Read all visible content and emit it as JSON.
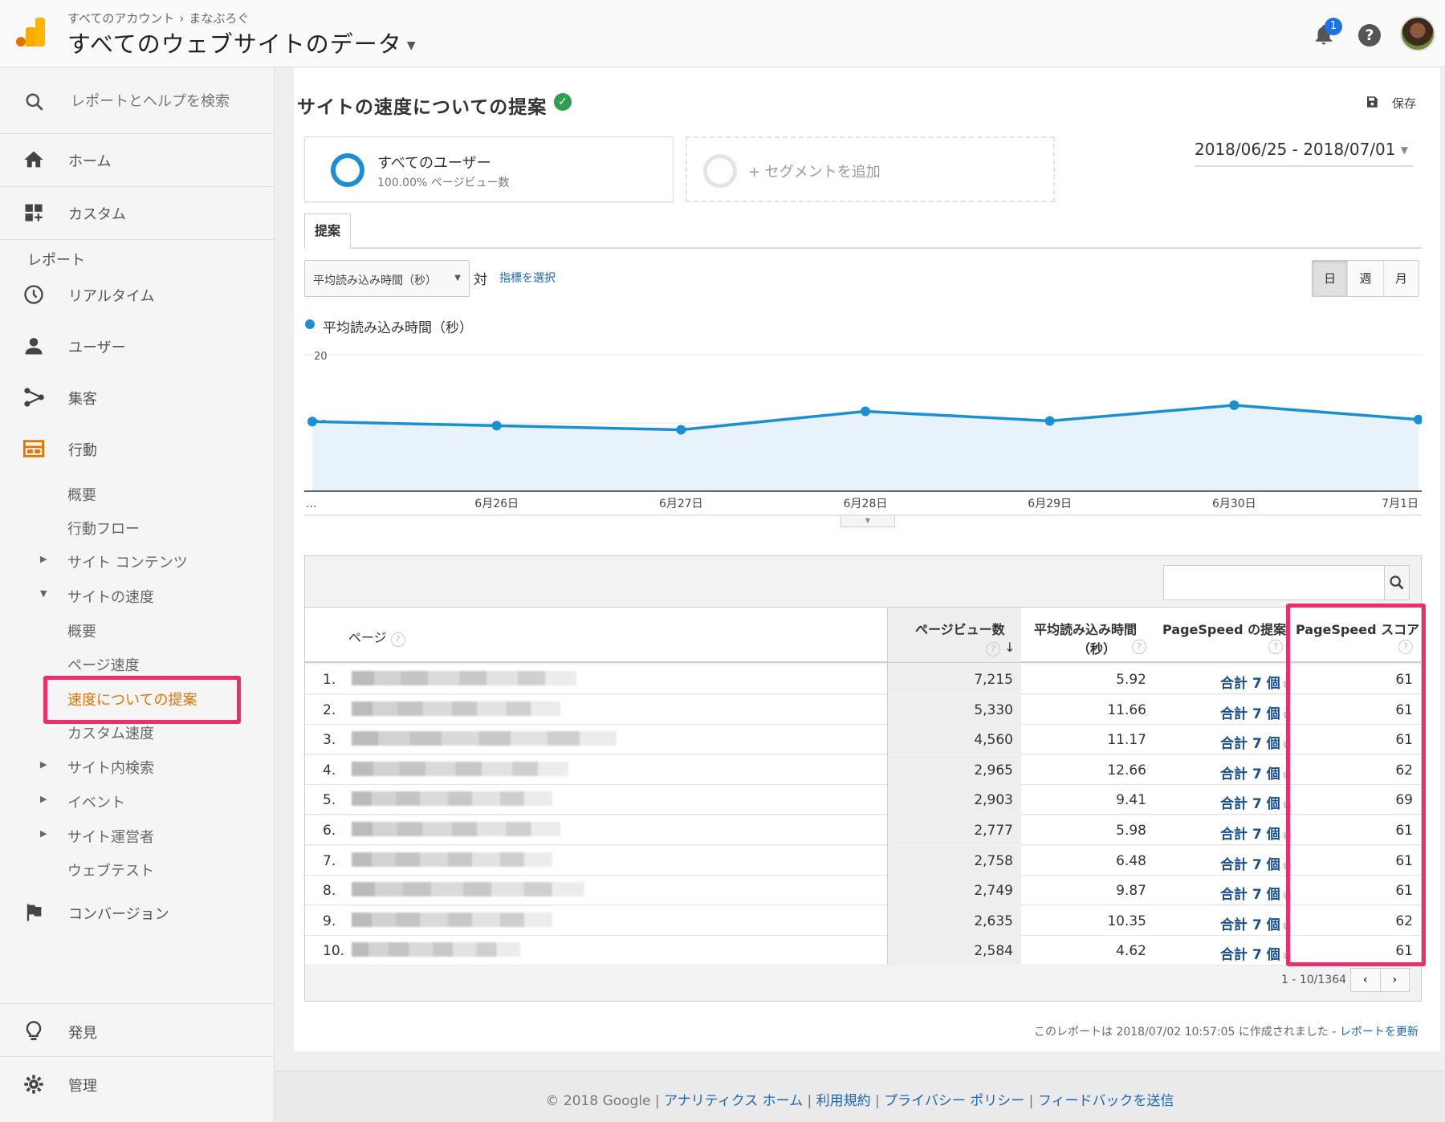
{
  "header": {
    "breadcrumb_account": "すべてのアカウント",
    "breadcrumb_property": "まなぶろぐ",
    "view_title": "すべてのウェブサイトのデータ",
    "notification_count": "1"
  },
  "sidebar": {
    "search_placeholder": "レポートとヘルプを検索",
    "home": "ホーム",
    "custom": "カスタム",
    "reports_heading": "レポート",
    "realtime": "リアルタイム",
    "users": "ユーザー",
    "acquisition": "集客",
    "behavior": "行動",
    "behavior_items": {
      "overview": "概要",
      "flow": "行動フロー",
      "site_content": "サイト コンテンツ",
      "site_speed": "サイトの速度",
      "speed_overview": "概要",
      "page_timings": "ページ速度",
      "speed_suggestions": "速度についての提案",
      "user_timings": "カスタム速度",
      "site_search": "サイト内検索",
      "events": "イベント",
      "publisher": "サイト運営者",
      "experiments": "ウェブテスト"
    },
    "conversions": "コンバージョン",
    "discover": "発見",
    "admin": "管理"
  },
  "report": {
    "title": "サイトの速度についての提案",
    "save_label": "保存",
    "segment_1_name": "すべてのユーザー",
    "segment_1_detail": "100.00% ページビュー数",
    "segment_add": "+ セグメントを追加",
    "date_range": "2018/06/25 - 2018/07/01",
    "tab_label": "提案",
    "metric_select": "平均読み込み時間（秒）",
    "vs_label": "対",
    "pick_metric": "指標を選択",
    "period_buttons": [
      "日",
      "週",
      "月"
    ],
    "legend": "平均読み込み時間（秒）"
  },
  "chart_data": {
    "type": "area",
    "series": [
      {
        "name": "平均読み込み時間（秒）",
        "values": [
          10.2,
          9.6,
          9.0,
          11.7,
          10.3,
          12.6,
          10.5
        ]
      }
    ],
    "x_labels": [
      "...",
      "6月26日",
      "6月27日",
      "6月28日",
      "6月29日",
      "6月30日",
      "7月1日"
    ],
    "y_ticks": [
      "20",
      "10"
    ],
    "ylim": [
      0,
      20
    ],
    "color": "#1a8fd1",
    "fill": "#e8f2fb",
    "grid": true
  },
  "table": {
    "headers": {
      "page": "ページ",
      "pageviews": "ページビュー数",
      "load_time_line1": "平均読み込み時間",
      "load_time_line2": "（秒）",
      "pagespeed_suggestions": "PageSpeed の提案",
      "pagespeed_score": "PageSpeed スコア"
    },
    "rows": [
      {
        "num": "1.",
        "pageviews": "7,215",
        "load_time": "5.92",
        "suggestions": "合計 7 個",
        "score": "61",
        "blur": 0.56
      },
      {
        "num": "2.",
        "pageviews": "5,330",
        "load_time": "11.66",
        "suggestions": "合計 7 個",
        "score": "61",
        "blur": 0.52
      },
      {
        "num": "3.",
        "pageviews": "4,560",
        "load_time": "11.17",
        "suggestions": "合計 7 個",
        "score": "61",
        "blur": 0.66
      },
      {
        "num": "4.",
        "pageviews": "2,965",
        "load_time": "12.66",
        "suggestions": "合計 7 個",
        "score": "62",
        "blur": 0.54
      },
      {
        "num": "5.",
        "pageviews": "2,903",
        "load_time": "9.41",
        "suggestions": "合計 7 個",
        "score": "69",
        "blur": 0.5
      },
      {
        "num": "6.",
        "pageviews": "2,777",
        "load_time": "5.98",
        "suggestions": "合計 7 個",
        "score": "61",
        "blur": 0.52
      },
      {
        "num": "7.",
        "pageviews": "2,758",
        "load_time": "6.48",
        "suggestions": "合計 7 個",
        "score": "61",
        "blur": 0.5
      },
      {
        "num": "8.",
        "pageviews": "2,749",
        "load_time": "9.87",
        "suggestions": "合計 7 個",
        "score": "61",
        "blur": 0.58
      },
      {
        "num": "9.",
        "pageviews": "2,635",
        "load_time": "10.35",
        "suggestions": "合計 7 個",
        "score": "62",
        "blur": 0.5
      },
      {
        "num": "10.",
        "pageviews": "2,584",
        "load_time": "4.62",
        "suggestions": "合計 7 個",
        "score": "61",
        "blur": 0.42
      }
    ],
    "pager": "1 - 10/1364",
    "created": "このレポートは 2018/07/02 10:57:05 に作成されました -",
    "refresh": "レポートを更新"
  },
  "footer": {
    "copyright": "© 2018 Google |",
    "links": [
      "アナリティクス ホーム",
      "利用規約",
      "プライバシー ポリシー",
      "フィードバックを送信"
    ]
  },
  "colors": {
    "accent": "#1a8fd1",
    "highlight": "#ec2e6e",
    "link": "#1a66b8",
    "active_nav": "#e37400"
  }
}
